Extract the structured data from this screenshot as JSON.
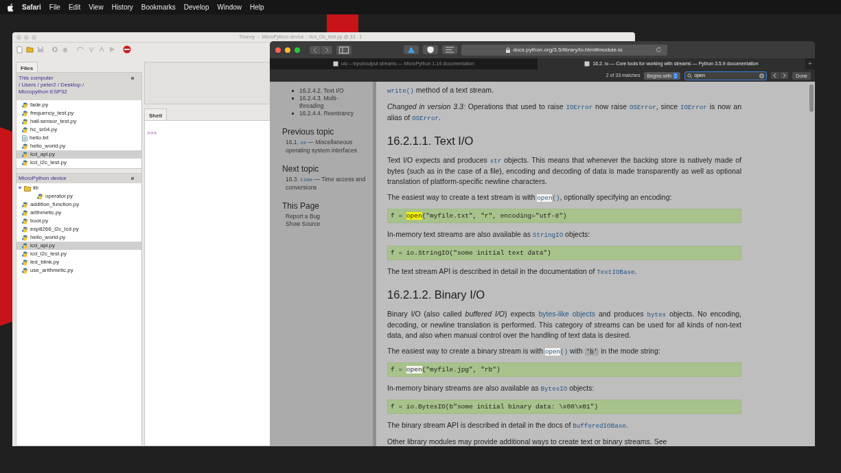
{
  "menu_bar": {
    "app": "Safari",
    "items": [
      "File",
      "Edit",
      "View",
      "History",
      "Bookmarks",
      "Develop",
      "Window",
      "Help"
    ]
  },
  "thonny": {
    "title": "Thonny  -  MicroPython device :: /lcd_i2c_test.py @ 33 : 1",
    "files_tab": "Files",
    "computer_panel": {
      "title": "This computer",
      "path": "/ Users / peter2 / Desktop / Micropython ESP32",
      "files": [
        {
          "name": "fade.py",
          "kind": "python",
          "selected": false
        },
        {
          "name": "frequency_test.py",
          "kind": "python",
          "selected": false
        },
        {
          "name": "hall-sensor_test.py",
          "kind": "python",
          "selected": false
        },
        {
          "name": "hc_sr04.py",
          "kind": "python",
          "selected": false
        },
        {
          "name": "hello.txt",
          "kind": "text",
          "selected": false
        },
        {
          "name": "hello_world.py",
          "kind": "python",
          "selected": false
        },
        {
          "name": "lcd_api.py",
          "kind": "python",
          "selected": true
        },
        {
          "name": "lcd_i2c_test.py",
          "kind": "python",
          "selected": false
        }
      ]
    },
    "device_panel": {
      "title": "MicroPython device",
      "files": [
        {
          "name": "lib",
          "kind": "folder",
          "selected": false,
          "expanded": true,
          "children": [
            {
              "name": "operator.py",
              "kind": "python",
              "selected": false
            }
          ]
        },
        {
          "name": "addition_function.py",
          "kind": "python",
          "selected": false
        },
        {
          "name": "arithmetic.py",
          "kind": "python",
          "selected": false
        },
        {
          "name": "boot.py",
          "kind": "python",
          "selected": false
        },
        {
          "name": "esp8266_i2c_lcd.py",
          "kind": "python",
          "selected": false
        },
        {
          "name": "hello_world.py",
          "kind": "python",
          "selected": false
        },
        {
          "name": "lcd_api.py",
          "kind": "python",
          "selected": true
        },
        {
          "name": "lcd_i2c_test.py",
          "kind": "python",
          "selected": false
        },
        {
          "name": "led_blink.py",
          "kind": "python",
          "selected": false
        },
        {
          "name": "use_arithmetic.py",
          "kind": "python",
          "selected": false
        }
      ]
    },
    "shell_tab": "Shell",
    "shell_prompt": ">>>"
  },
  "safari": {
    "new_tab": "+",
    "url": "docs.python.org/3.5/library/io.html#module-io",
    "tabs": [
      {
        "label": "uio – input/output streams — MicroPython 1.14 documentation",
        "selected": false
      },
      {
        "label": "16.2. io — Core tools for working with streams — Python 3.5.9 documentation",
        "selected": true
      }
    ],
    "find": {
      "matches": "2 of 33 matches",
      "mode": "Begins with",
      "query": "open",
      "done": "Done"
    },
    "sidebar": {
      "toc": [
        "16.2.4.2. Text I/O",
        "16.2.4.3. Multi-threading",
        "16.2.4.4. Reentrancy"
      ],
      "sections": [
        {
          "heading": "Previous topic",
          "links": [
            [
              {
                "kind": "text",
                "text": "16.1. "
              },
              {
                "kind": "code",
                "text": "os"
              },
              {
                "kind": "text",
                "text": " — Miscellaneous operating system interfaces"
              }
            ]
          ]
        },
        {
          "heading": "Next topic",
          "links": [
            [
              {
                "kind": "text",
                "text": "16.3. "
              },
              {
                "kind": "code",
                "text": "time"
              },
              {
                "kind": "text",
                "text": " — Time access and conversions"
              }
            ]
          ]
        },
        {
          "heading": "This Page",
          "links": [
            [
              {
                "kind": "text",
                "text": "Report a Bug"
              }
            ],
            [
              {
                "kind": "text",
                "text": "Show Source"
              }
            ]
          ]
        }
      ]
    },
    "content": [
      {
        "kind": "paragraph",
        "segments": [
          {
            "kind": "code",
            "text": "write()"
          },
          {
            "kind": "text",
            "text": " method of a text stream."
          }
        ]
      },
      {
        "kind": "paragraph",
        "segments": [
          {
            "kind": "em",
            "text": "Changed in version 3.3:"
          },
          {
            "kind": "text",
            "text": " Operations that used to raise "
          },
          {
            "kind": "code",
            "text": "IOError"
          },
          {
            "kind": "text",
            "text": " now raise "
          },
          {
            "kind": "code",
            "text": "OSError"
          },
          {
            "kind": "text",
            "text": ", since "
          },
          {
            "kind": "code",
            "text": "IOError"
          },
          {
            "kind": "text",
            "text": " is now an alias of "
          },
          {
            "kind": "code",
            "text": "OSError"
          },
          {
            "kind": "text",
            "text": "."
          }
        ]
      },
      {
        "kind": "heading",
        "segments": [
          {
            "kind": "text",
            "text": "16.2.1.1. Text I/O"
          }
        ]
      },
      {
        "kind": "paragraph",
        "segments": [
          {
            "kind": "text",
            "text": "Text I/O expects and produces "
          },
          {
            "kind": "code",
            "text": "str"
          },
          {
            "kind": "text",
            "text": " objects. This means that whenever the backing store is natively made of bytes (such as in the case of a file), encoding and decoding of data is made transparently as well as optional translation of platform-specific newline characters."
          }
        ]
      },
      {
        "kind": "paragraph",
        "segments": [
          {
            "kind": "text",
            "text": "The easiest way to create a text stream is with "
          },
          {
            "kind": "code",
            "text": "open",
            "found": true,
            "current": false
          },
          {
            "kind": "code",
            "text": "()"
          },
          {
            "kind": "text",
            "text": ", optionally specifying an encoding:"
          }
        ]
      },
      {
        "kind": "code",
        "segments": [
          {
            "kind": "text",
            "text": "f = "
          },
          {
            "kind": "text",
            "text": "open",
            "found": true,
            "current": true
          },
          {
            "kind": "text",
            "text": "(\"myfile.txt\", \"r\", encoding=\"utf-8\")"
          }
        ]
      },
      {
        "kind": "paragraph",
        "segments": [
          {
            "kind": "text",
            "text": "In-memory text streams are also available as "
          },
          {
            "kind": "code",
            "text": "StringIO"
          },
          {
            "kind": "text",
            "text": " objects:"
          }
        ]
      },
      {
        "kind": "code",
        "segments": [
          {
            "kind": "text",
            "text": "f = io.StringIO(\"some initial text data\")"
          }
        ]
      },
      {
        "kind": "paragraph",
        "segments": [
          {
            "kind": "text",
            "text": "The text stream API is described in detail in the documentation of "
          },
          {
            "kind": "code",
            "text": "TextIOBase"
          },
          {
            "kind": "text",
            "text": "."
          }
        ]
      },
      {
        "kind": "heading",
        "segments": [
          {
            "kind": "text",
            "text": "16.2.1.2. Binary I/O"
          }
        ]
      },
      {
        "kind": "paragraph",
        "segments": [
          {
            "kind": "text",
            "text": "Binary I/O (also called "
          },
          {
            "kind": "em",
            "text": "buffered I/O"
          },
          {
            "kind": "text",
            "text": ") expects "
          },
          {
            "kind": "link",
            "text": "bytes-like objects"
          },
          {
            "kind": "text",
            "text": " and produces "
          },
          {
            "kind": "code",
            "text": "bytes"
          },
          {
            "kind": "text",
            "text": " objects. No encoding, decoding, or newline translation is performed. This category of streams can be used for all kinds of non-text data, and also when manual control over the handling of text data is desired."
          }
        ]
      },
      {
        "kind": "paragraph",
        "segments": [
          {
            "kind": "text",
            "text": "The easiest way to create a binary stream is with "
          },
          {
            "kind": "code",
            "text": "open",
            "found": true,
            "current": false
          },
          {
            "kind": "code",
            "text": "()"
          },
          {
            "kind": "text",
            "text": " with "
          },
          {
            "kind": "literal",
            "text": "'b'"
          },
          {
            "kind": "text",
            "text": " in the mode string:"
          }
        ]
      },
      {
        "kind": "code",
        "segments": [
          {
            "kind": "text",
            "text": "f = "
          },
          {
            "kind": "text",
            "text": "open",
            "found": true,
            "current": false
          },
          {
            "kind": "text",
            "text": "(\"myfile.jpg\", \"rb\")"
          }
        ]
      },
      {
        "kind": "paragraph",
        "segments": [
          {
            "kind": "text",
            "text": "In-memory binary streams are also available as "
          },
          {
            "kind": "code",
            "text": "BytesIO"
          },
          {
            "kind": "text",
            "text": " objects:"
          }
        ]
      },
      {
        "kind": "code",
        "segments": [
          {
            "kind": "text",
            "text": "f = io.BytesIO(b\"some initial binary data: \\x00\\x01\")"
          }
        ]
      },
      {
        "kind": "paragraph",
        "segments": [
          {
            "kind": "text",
            "text": "The binary stream API is described in detail in the docs of "
          },
          {
            "kind": "code",
            "text": "BufferedIOBase"
          },
          {
            "kind": "text",
            "text": "."
          }
        ]
      },
      {
        "kind": "paragraph",
        "segments": [
          {
            "kind": "text",
            "text": "Other library modules may provide additional ways to create text or binary streams. See"
          }
        ]
      }
    ]
  }
}
